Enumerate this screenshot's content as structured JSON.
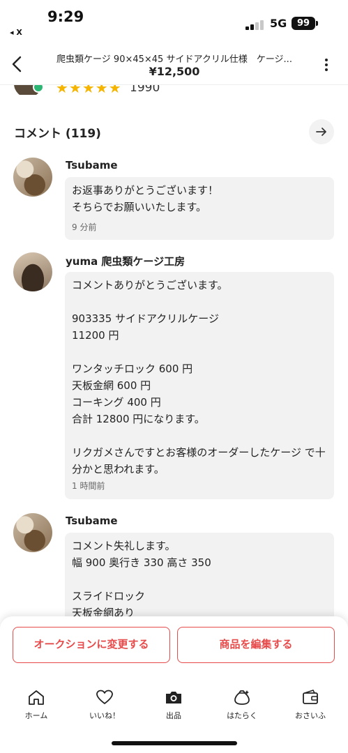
{
  "status_bar": {
    "time": "9:29",
    "back_app": "◂ X",
    "network": "5G",
    "battery": "99"
  },
  "header": {
    "title": "爬虫類ケージ 90×45×45 サイドアクリル仕様　ケージ...",
    "price": "¥12,500"
  },
  "seller": {
    "rating_stars": "★★★★★",
    "rating_count": "1990"
  },
  "comments_section": {
    "title": "コメント (119)"
  },
  "comments": [
    {
      "name": "Tsubame",
      "text": "お返事ありがとうございます！\nそちらでお願いいたします。",
      "time": "9 分前"
    },
    {
      "name": "yuma 爬虫類ケージ工房",
      "text": "コメントありがとうございます。\n\n903335 サイドアクリルケージ\n11200 円\n\nワンタッチロック 600 円\n天板金網 600 円\nコーキング 400 円\n合計 12800 円になります。\n\nリクガメさんですとお客様のオーダーしたケージ で十分かと思われます。",
      "time": "1 時間前"
    },
    {
      "name": "Tsubame",
      "text": "コメント失礼します。\n幅 900 奥行き 330 高さ 350\n\nスライドロック\n天板金網あり",
      "time": ""
    }
  ],
  "actions": {
    "auction_label": "オークションに変更する",
    "edit_label": "商品を編集する"
  },
  "tabs": [
    {
      "label": "ホーム",
      "icon": "home-icon"
    },
    {
      "label": "いいね！",
      "icon": "heart-icon"
    },
    {
      "label": "出品",
      "icon": "camera-icon"
    },
    {
      "label": "はたらく",
      "icon": "money-bag-icon"
    },
    {
      "label": "おさいふ",
      "icon": "wallet-icon"
    }
  ],
  "colors": {
    "accent": "#e64a4a",
    "bubble": "#f2f2f2",
    "star": "#f5b400"
  }
}
